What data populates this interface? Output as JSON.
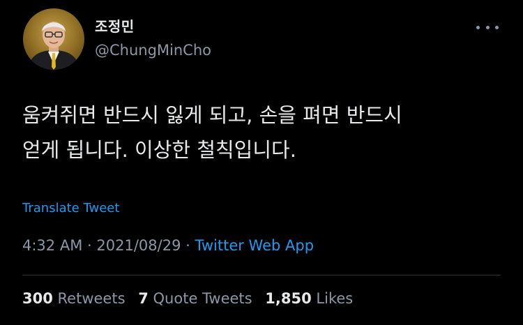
{
  "author": {
    "display_name": "조정민",
    "handle": "@ChungMinCho",
    "avatar_icon": "avatar-photo"
  },
  "tweet": {
    "text_line1": "움켜쥐면 반드시 잃게 되고, 손을 펴면 반드시",
    "text_line2": "얻게 됩니다. 이상한 철칙입니다.",
    "translate_label": "Translate Tweet",
    "time": "4:32 AM",
    "separator": "·",
    "date": "2021/08/29",
    "source": "Twitter Web App"
  },
  "stats": {
    "retweets_count": "300",
    "retweets_label": "Retweets",
    "quotes_count": "7",
    "quotes_label": "Quote Tweets",
    "likes_count": "1,850",
    "likes_label": "Likes"
  },
  "colors": {
    "background": "#000000",
    "text_primary": "#e7e9ea",
    "text_secondary": "#8b98a5",
    "link": "#1d9bf0",
    "divider": "#2f3336"
  }
}
